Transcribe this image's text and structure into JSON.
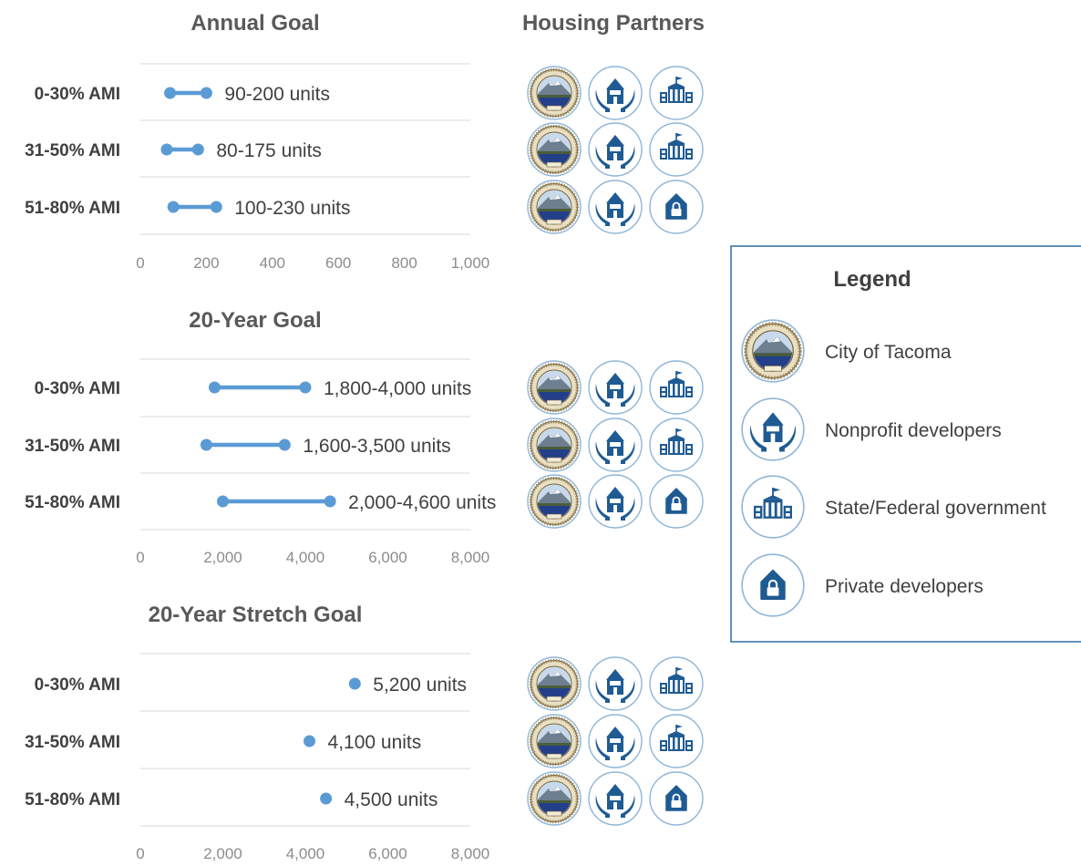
{
  "partners_title": "Housing Partners",
  "colors": {
    "accent": "#5b9bd5",
    "icon_blue": "#1f5b93",
    "ring": "#8fb6d8",
    "gridline": "#d9d9d9",
    "legend_border": "#2e6a9e"
  },
  "legend": {
    "title": "Legend",
    "items": [
      {
        "icon": "city-seal-icon",
        "label": "City of Tacoma"
      },
      {
        "icon": "nonprofit-house-hands-icon",
        "label": "Nonprofit developers"
      },
      {
        "icon": "government-building-icon",
        "label": "State/Federal government"
      },
      {
        "icon": "private-house-lock-icon",
        "label": "Private developers"
      }
    ]
  },
  "chart_data": [
    {
      "type": "dumbbell",
      "title": "Annual Goal",
      "categories": [
        "0-30% AMI",
        "31-50% AMI",
        "51-80% AMI"
      ],
      "ranges": [
        [
          90,
          200
        ],
        [
          80,
          175
        ],
        [
          100,
          230
        ]
      ],
      "labels": [
        "90-200 units",
        "80-175 units",
        "100-230 units"
      ],
      "xlim": [
        0,
        1000
      ],
      "xticks": [
        "0",
        "200",
        "400",
        "600",
        "800",
        "1,000"
      ],
      "partners": [
        [
          "city-seal-icon",
          "nonprofit-house-hands-icon",
          "government-building-icon"
        ],
        [
          "city-seal-icon",
          "nonprofit-house-hands-icon",
          "government-building-icon"
        ],
        [
          "city-seal-icon",
          "nonprofit-house-hands-icon",
          "private-house-lock-icon"
        ]
      ]
    },
    {
      "type": "dumbbell",
      "title": "20-Year Goal",
      "categories": [
        "0-30% AMI",
        "31-50% AMI",
        "51-80% AMI"
      ],
      "ranges": [
        [
          1800,
          4000
        ],
        [
          1600,
          3500
        ],
        [
          2000,
          4600
        ]
      ],
      "labels": [
        "1,800-4,000 units",
        "1,600-3,500 units",
        "2,000-4,600 units"
      ],
      "xlim": [
        0,
        8000
      ],
      "xticks": [
        "0",
        "2,000",
        "4,000",
        "6,000",
        "8,000"
      ],
      "partners": [
        [
          "city-seal-icon",
          "nonprofit-house-hands-icon",
          "government-building-icon"
        ],
        [
          "city-seal-icon",
          "nonprofit-house-hands-icon",
          "government-building-icon"
        ],
        [
          "city-seal-icon",
          "nonprofit-house-hands-icon",
          "private-house-lock-icon"
        ]
      ]
    },
    {
      "type": "dot",
      "title": "20-Year Stretch Goal",
      "categories": [
        "0-30% AMI",
        "31-50% AMI",
        "51-80% AMI"
      ],
      "values": [
        5200,
        4100,
        4500
      ],
      "labels": [
        "5,200 units",
        "4,100 units",
        "4,500 units"
      ],
      "xlim": [
        0,
        8000
      ],
      "xticks": [
        "0",
        "2,000",
        "4,000",
        "6,000",
        "8,000"
      ],
      "partners": [
        [
          "city-seal-icon",
          "nonprofit-house-hands-icon",
          "government-building-icon"
        ],
        [
          "city-seal-icon",
          "nonprofit-house-hands-icon",
          "government-building-icon"
        ],
        [
          "city-seal-icon",
          "nonprofit-house-hands-icon",
          "private-house-lock-icon"
        ]
      ]
    }
  ]
}
